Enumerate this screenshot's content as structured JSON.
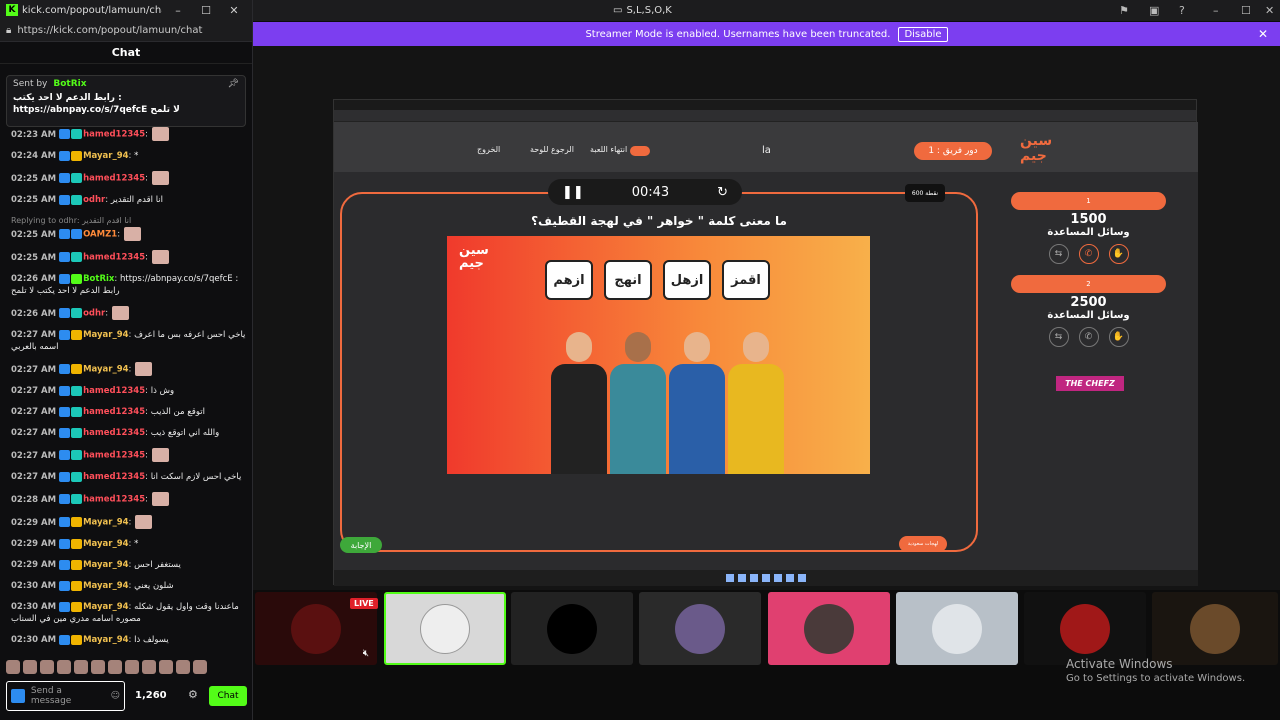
{
  "chat_window": {
    "title": "kick.com/popout/lamuun/chat -...",
    "url": "https://kick.com/popout/lamuun/chat",
    "header": "Chat",
    "pinned": {
      "sent_by": "Sent by",
      "bot": "BotRix",
      "message": "رابط الدعم لا احد يكتب : https://abnpay.co/s/7qefcE لا تلمح"
    },
    "messages": [
      {
        "ts": "02:23 AM",
        "user": "hamed12345",
        "color": "red",
        "text": ""
      },
      {
        "ts": "02:24 AM",
        "user": "Mayar_94",
        "color": "yel",
        "text": "*"
      },
      {
        "ts": "02:25 AM",
        "user": "hamed12345",
        "color": "red",
        "text": ""
      },
      {
        "ts": "02:25 AM",
        "user": "odhr",
        "color": "red",
        "text": "انا اقدم التقدير"
      },
      {
        "ts": "02:25 AM",
        "user": "OAMZ1",
        "color": "org",
        "text": "",
        "reply": "Replying to odhr: انا اقدم التقدير"
      },
      {
        "ts": "02:25 AM",
        "user": "hamed12345",
        "color": "red",
        "text": ""
      },
      {
        "ts": "02:26 AM",
        "user": "BotRix",
        "color": "grn",
        "text": "https://abnpay.co/s/7qefcE : رابط الدعم لا احد يكتب لا تلمح"
      },
      {
        "ts": "02:26 AM",
        "user": "odhr",
        "color": "red",
        "text": ""
      },
      {
        "ts": "02:27 AM",
        "user": "Mayar_94",
        "color": "yel",
        "text": "ياخي احس اعرفه بس ما اعرف اسمه بالعربي"
      },
      {
        "ts": "02:27 AM",
        "user": "Mayar_94",
        "color": "yel",
        "text": ""
      },
      {
        "ts": "02:27 AM",
        "user": "hamed12345",
        "color": "red",
        "text": "وش ذا"
      },
      {
        "ts": "02:27 AM",
        "user": "hamed12345",
        "color": "red",
        "text": "اتوقع من الذيب"
      },
      {
        "ts": "02:27 AM",
        "user": "hamed12345",
        "color": "red",
        "text": "والله اني اتوقع ذيب"
      },
      {
        "ts": "02:27 AM",
        "user": "hamed12345",
        "color": "red",
        "text": ""
      },
      {
        "ts": "02:27 AM",
        "user": "hamed12345",
        "color": "red",
        "text": "ياخي احس لازم اسكت انا"
      },
      {
        "ts": "02:28 AM",
        "user": "hamed12345",
        "color": "red",
        "text": ""
      },
      {
        "ts": "02:29 AM",
        "user": "Mayar_94",
        "color": "yel",
        "text": ""
      },
      {
        "ts": "02:29 AM",
        "user": "Mayar_94",
        "color": "yel",
        "text": "*"
      },
      {
        "ts": "02:29 AM",
        "user": "Mayar_94",
        "color": "yel",
        "text": "يستغفر احس"
      },
      {
        "ts": "02:30 AM",
        "user": "Mayar_94",
        "color": "yel",
        "text": "شلون يعني"
      },
      {
        "ts": "02:30 AM",
        "user": "Mayar_94",
        "color": "yel",
        "text": "ماعندنا وقت واول يقول شكله مصوره اسامه مدري مين في السناب"
      },
      {
        "ts": "02:30 AM",
        "user": "Mayar_94",
        "color": "yel",
        "text": "يسولف ذا"
      }
    ],
    "input_placeholder": "Send a message",
    "points": "1,260",
    "chat_button": "Chat"
  },
  "top": {
    "title": "S,L,S,O,K",
    "banner": "Streamer Mode is enabled. Usernames have been truncated.",
    "disable": "Disable"
  },
  "game": {
    "team_turn": "دور فريق : 1",
    "opt1": "الخروج",
    "opt2": "الرجوع للوحة",
    "opt3": "انتهاء اللعبة",
    "la": "la",
    "timer": "00:43",
    "points": "600 نقطة",
    "question": "ما معنى كلمة \" خواهر \" في لهجة القطيف؟",
    "choices": [
      "ازهم",
      "انهج",
      "ازهل",
      "اقمز"
    ],
    "answer": "الإجابة",
    "hint": "لهجات سعودية",
    "teams": [
      {
        "num": "1",
        "score": "1500",
        "label": "وسائل المساعدة"
      },
      {
        "num": "2",
        "score": "2500",
        "label": "وسائل المساعدة"
      }
    ],
    "sponsor": "THE CHEFZ"
  },
  "participants": {
    "live": "LIVE"
  },
  "watermark": {
    "title": "Activate Windows",
    "sub": "Go to Settings to activate Windows."
  }
}
